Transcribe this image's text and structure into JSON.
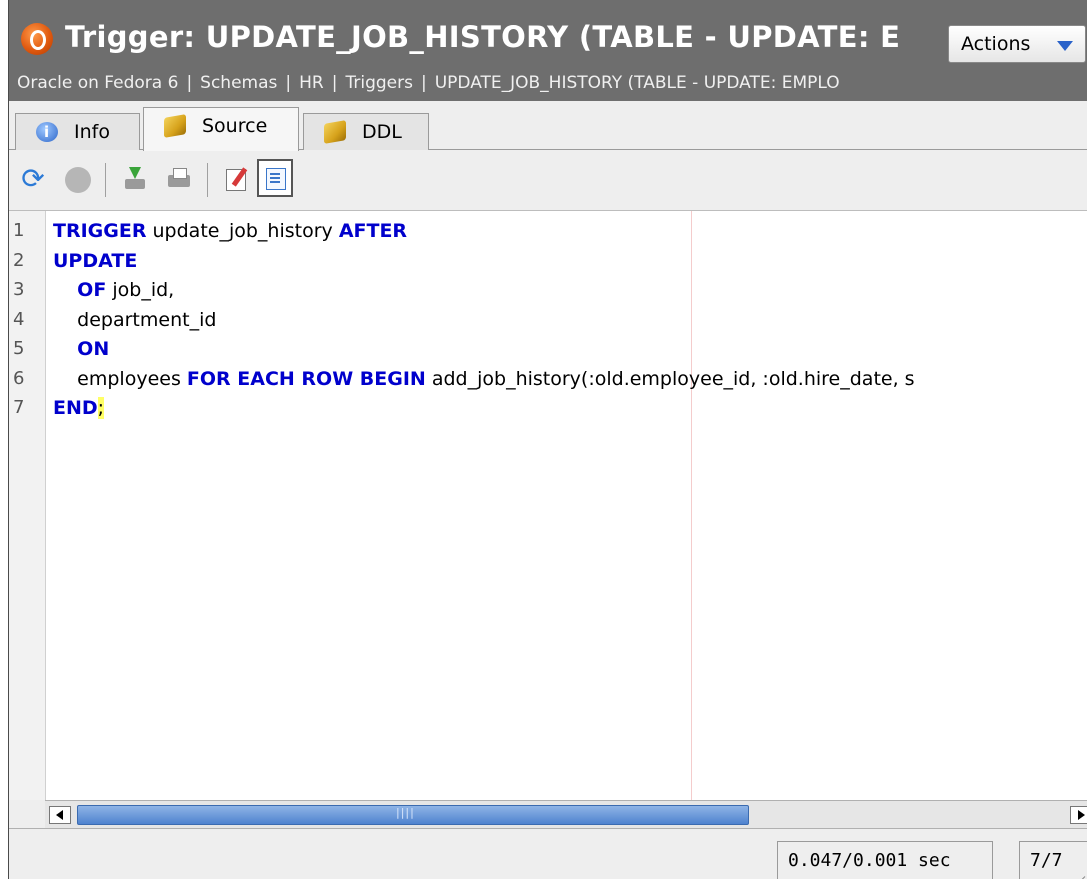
{
  "header": {
    "title": "Trigger: UPDATE_JOB_HISTORY   (TABLE - UPDATE: E",
    "actions_label": "Actions",
    "breadcrumb": [
      "Oracle on Fedora 6",
      "Schemas",
      "HR",
      "Triggers",
      "UPDATE_JOB_HISTORY  (TABLE - UPDATE: EMPLO"
    ],
    "icon": "oracle-o-icon"
  },
  "tabs": [
    {
      "label": "Info",
      "icon": "info-icon",
      "active": false
    },
    {
      "label": "Source",
      "icon": "cube-icon",
      "active": true
    },
    {
      "label": "DDL",
      "icon": "cube-icon",
      "active": false
    }
  ],
  "toolbar": [
    "refresh-icon",
    "stop-icon",
    "download-icon",
    "print-icon",
    "edit-icon",
    "format-icon"
  ],
  "editor": {
    "lines": [
      {
        "num": "1",
        "tokens": [
          {
            "t": "TRIGGER",
            "kw": true
          },
          {
            "t": " update_job_history ",
            "kw": false
          },
          {
            "t": "AFTER",
            "kw": true
          }
        ]
      },
      {
        "num": "2",
        "tokens": [
          {
            "t": "UPDATE",
            "kw": true
          }
        ]
      },
      {
        "num": "3",
        "tokens": [
          {
            "t": "    ",
            "kw": false
          },
          {
            "t": "OF",
            "kw": true
          },
          {
            "t": " job_id,",
            "kw": false
          }
        ]
      },
      {
        "num": "4",
        "tokens": [
          {
            "t": "    department_id",
            "kw": false
          }
        ]
      },
      {
        "num": "5",
        "tokens": [
          {
            "t": "    ",
            "kw": false
          },
          {
            "t": "ON",
            "kw": true
          }
        ]
      },
      {
        "num": "6",
        "tokens": [
          {
            "t": "    employees ",
            "kw": false
          },
          {
            "t": "FOR EACH ROW BEGIN",
            "kw": true
          },
          {
            "t": " add_job_history(:old.employee_id, :old.hire_date, s",
            "kw": false
          }
        ]
      },
      {
        "num": "7",
        "tokens": [
          {
            "t": "END",
            "kw": true
          },
          {
            "t": ";",
            "kw": false,
            "hl": true
          }
        ]
      }
    ]
  },
  "status": {
    "timing": "0.047/0.001 sec",
    "position": "7/7"
  },
  "colors": {
    "header_bg": "#6e6e6e",
    "keyword": "#0000cc",
    "highlight": "#ffff66",
    "scroll_thumb": "#4f83cf"
  }
}
